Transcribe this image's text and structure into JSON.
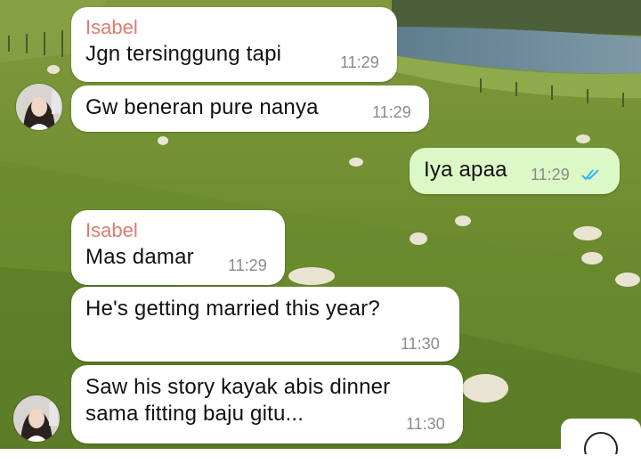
{
  "chat": {
    "messages": [
      {
        "direction": "incoming",
        "sender": "Isabel",
        "text": "Jgn tersinggung tapi",
        "time": "11:29"
      },
      {
        "direction": "incoming",
        "text": "Gw beneran pure nanya",
        "time": "11:29"
      },
      {
        "direction": "outgoing",
        "text": "Iya apaa",
        "time": "11:29",
        "status": "read"
      },
      {
        "direction": "incoming",
        "sender": "Isabel",
        "text": "Mas damar",
        "time": "11:29"
      },
      {
        "direction": "incoming",
        "text": "He's getting married this year?",
        "time": "11:30"
      },
      {
        "direction": "incoming",
        "text_line1": "Saw his story kayak abis dinner",
        "text_line2": "sama fitting baju gitu...",
        "time": "11:30"
      }
    ],
    "colors": {
      "sender_name": "#e07a6e",
      "outgoing_bubble": "#dcf8c6",
      "incoming_bubble": "#ffffff",
      "read_ticks": "#34b7f1"
    },
    "icons": {
      "avatar": "profile-photo",
      "read_receipt": "double-check-icon",
      "scroll_button": "scroll-down-icon"
    }
  }
}
